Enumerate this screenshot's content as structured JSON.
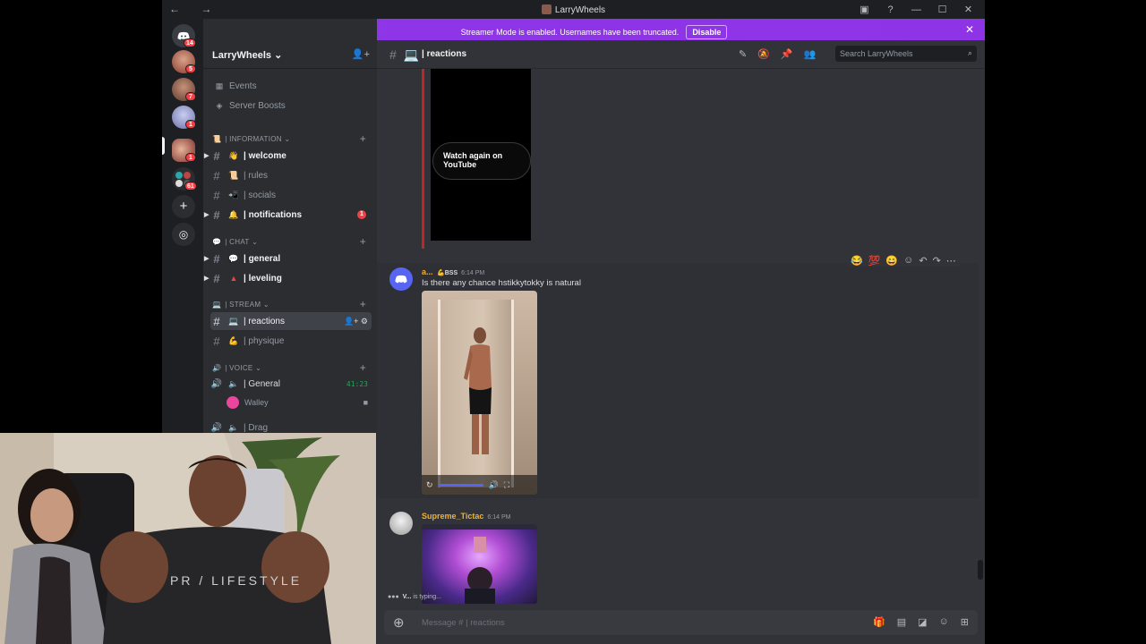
{
  "window": {
    "title": "LarryWheels",
    "nav": "← →"
  },
  "banner": {
    "text": "Streamer Mode is enabled. Usernames have been truncated.",
    "button": "Disable"
  },
  "rail": {
    "badges": [
      "14",
      "5",
      "7",
      "1",
      "1",
      "61"
    ]
  },
  "server": {
    "name": "LarryWheels"
  },
  "sidebar": {
    "events": "Events",
    "boosts": "Server Boosts",
    "categories": {
      "information": "| INFORMATION",
      "chat": "| CHAT",
      "stream": "| STREAM",
      "voice": "| VOICE"
    },
    "channels": {
      "welcome": "| welcome",
      "rules": "| rules",
      "socials": "| socials",
      "notifications": "| notifications",
      "notifications_count": "1",
      "general": "| general",
      "leveling": "| leveling",
      "reactions": "| reactions",
      "physique": "| physique",
      "voice_general": "| General",
      "voice_time": "41:23",
      "voice_user": "Walley",
      "drag": "| Drag"
    }
  },
  "header": {
    "channel": "| reactions",
    "search_placeholder": "Search LarryWheels"
  },
  "messages": {
    "embed_watch_again": "Watch again on YouTube",
    "m1_user": "a...",
    "m1_tag": "BSS",
    "m1_time": "6:14 PM",
    "m1_text": "Is there any chance hstikkytokky is natural",
    "m2_user": "Supreme_Tictac",
    "m2_time": "6:14 PM"
  },
  "typing": {
    "user": "V...",
    "text": "is typing..."
  },
  "composer": {
    "placeholder": "Message # | reactions"
  },
  "colors": {
    "accent": "#5865f2",
    "banner": "#8e36e8",
    "user_gold": "#f0b232",
    "mention_red": "#f23f43"
  }
}
